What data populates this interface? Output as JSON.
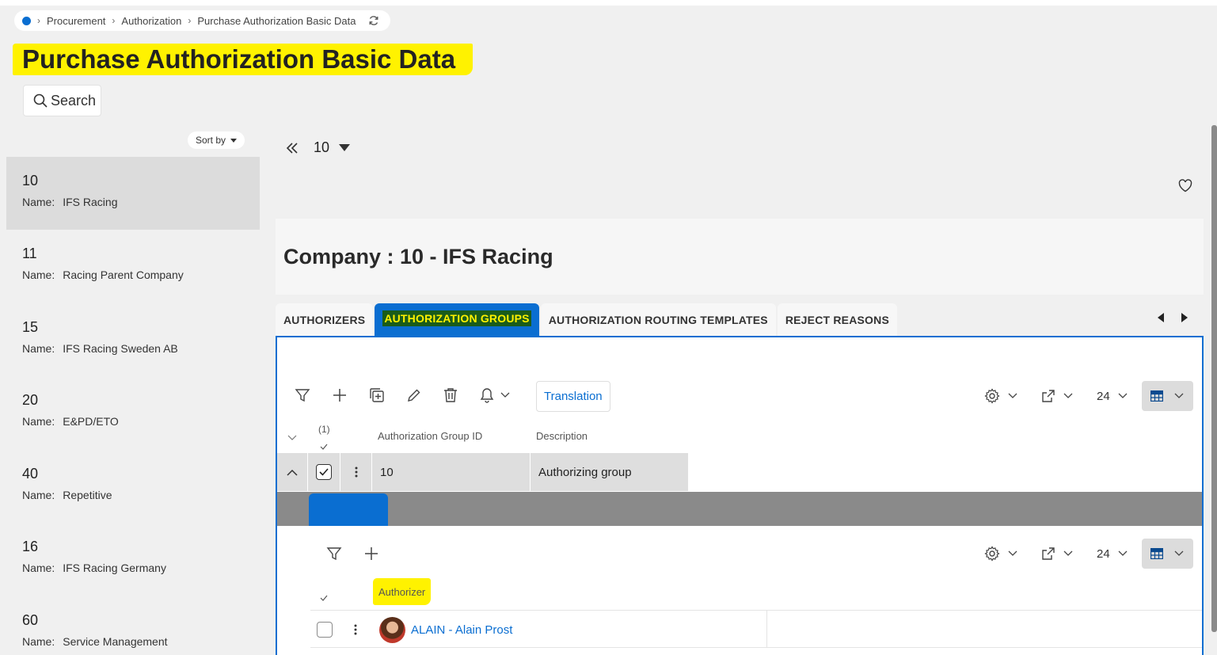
{
  "breadcrumb": {
    "items": [
      "Procurement",
      "Authorization",
      "Purchase Authorization Basic Data"
    ]
  },
  "page": {
    "title": "Purchase Authorization Basic Data",
    "search_label": "Search"
  },
  "list": {
    "sort_label": "Sort by",
    "name_label": "Name:",
    "items": [
      {
        "id": "10",
        "name": "IFS Racing"
      },
      {
        "id": "11",
        "name": "Racing Parent Company"
      },
      {
        "id": "15",
        "name": "IFS Racing Sweden AB"
      },
      {
        "id": "20",
        "name": "E&PD/ETO"
      },
      {
        "id": "40",
        "name": "Repetitive"
      },
      {
        "id": "16",
        "name": "IFS Racing Germany"
      },
      {
        "id": "60",
        "name": "Service Management"
      }
    ]
  },
  "nav": {
    "current": "10"
  },
  "company": {
    "title": "Company : 10 - IFS Racing"
  },
  "tabs": [
    "AUTHORIZERS",
    "AUTHORIZATION GROUPS",
    "AUTHORIZATION ROUTING TEMPLATES",
    "REJECT REASONS"
  ],
  "toolbar": {
    "translation_label": "Translation",
    "page_size": "24"
  },
  "grid": {
    "selected_count": "(1)",
    "columns": [
      "Authorization Group ID",
      "Description"
    ],
    "rows": [
      {
        "group_id": "10",
        "description": "Authorizing group"
      }
    ]
  },
  "detail": {
    "page_size": "24",
    "column_authorizer": "Authorizer",
    "rows": [
      {
        "authorizer": "ALAIN - Alain Prost"
      }
    ]
  },
  "colors": {
    "accent": "#0a6ed1",
    "highlight": "#fff200"
  }
}
